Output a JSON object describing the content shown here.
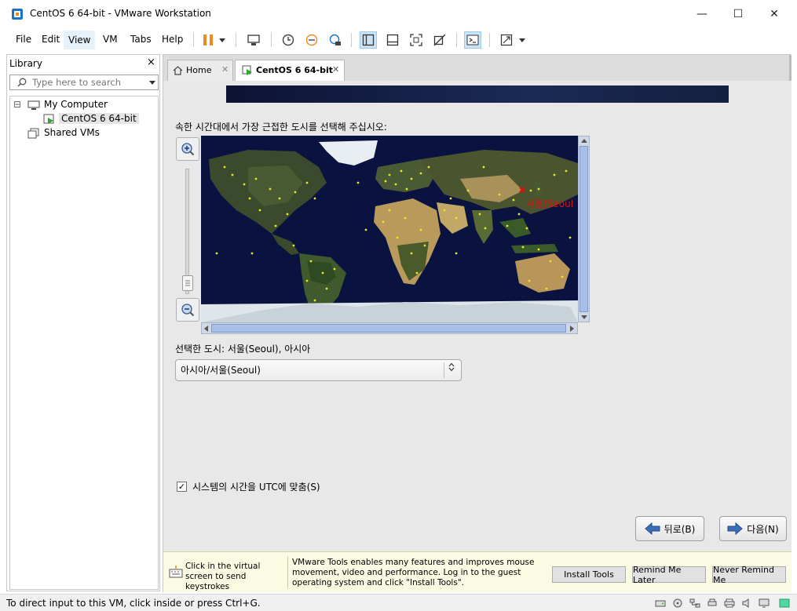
{
  "window": {
    "title": "CentOS 6 64-bit - VMware Workstation",
    "minimize": "—",
    "maximize": "☐",
    "close": "✕"
  },
  "menu": {
    "items": [
      "File",
      "Edit",
      "View",
      "VM",
      "Tabs",
      "Help"
    ]
  },
  "library": {
    "title": "Library",
    "close": "×",
    "search_placeholder": "Type here to search",
    "tree": {
      "my_computer": "My Computer",
      "vm": "CentOS 6 64-bit",
      "shared": "Shared VMs",
      "collapse": "⊟"
    }
  },
  "tabs": {
    "home": "Home",
    "vm": "CentOS 6 64-bit",
    "close": "✕"
  },
  "installer": {
    "instruction": "속한 시간대에서 가장 근접한 도시를 선택해 주십시오:",
    "map_marker_label": "서울(Seoul",
    "selected_city": "선택한 도시: 서울(Seoul), 아시아",
    "timezone_value": "아시아/서울(Seoul)",
    "utc_label": "시스템의 시간을 UTC에 맞춤(S)",
    "utc_checked": true,
    "back": "뒤로(B)",
    "next": "다음(N)"
  },
  "tools_bar": {
    "click_hint": "Click in the virtual screen to send keystrokes",
    "message": "VMware Tools enables many features and improves mouse movement, video and performance. Log in to the guest operating system and click \"Install Tools\".",
    "install": "Install Tools",
    "remind_later": "Remind Me Later",
    "never_remind": "Never Remind Me"
  },
  "status": {
    "text": "To direct input to this VM, click inside or press Ctrl+G."
  },
  "colors": {
    "accent_orange": "#f08a1c",
    "map_ocean": "#0a1240",
    "city_dot": "#e8e82a",
    "marker_red": "#e01010"
  }
}
